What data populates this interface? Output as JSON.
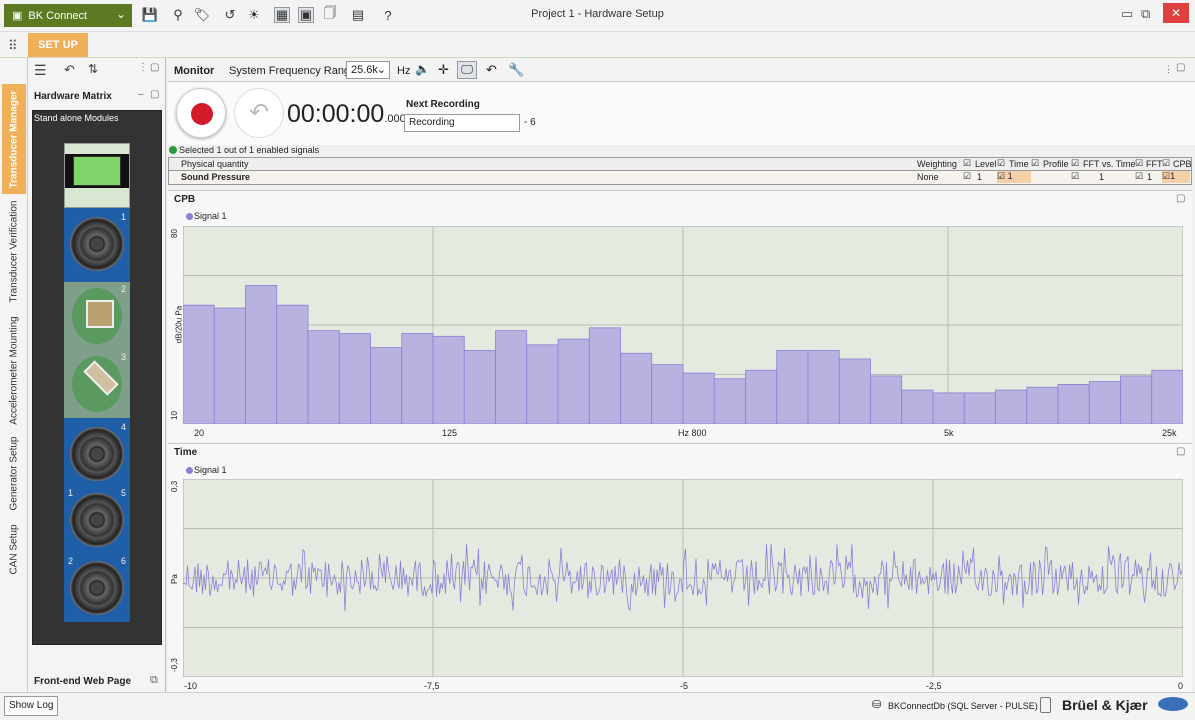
{
  "app": {
    "app_button": "BK Connect",
    "window_title": "Project 1 - Hardware Setup",
    "ribbon_tab": "SET UP"
  },
  "left_tabs": [
    "Transducer Manager",
    "Transducer Verification",
    "Accelerometer Mounting",
    "Generator Setup",
    "CAN Setup"
  ],
  "hardware_panel": {
    "title": "Hardware Matrix",
    "subtitle": "Stand alone Modules",
    "front_end": "Front-end Web Page",
    "channel_numbers": [
      "1",
      "2",
      "3",
      "4",
      "1",
      "5",
      "2",
      "6"
    ]
  },
  "monitor": {
    "title": "Monitor",
    "freq_label": "System Frequency Range:",
    "freq_value": "25.6k",
    "freq_unit": "Hz"
  },
  "recording": {
    "timer_main": "00:00:00",
    "timer_ms": ".000",
    "next_label": "Next Recording",
    "next_value": "Recording",
    "next_suffix": "- 6",
    "status": "Selected 1 out of 1 enabled signals"
  },
  "signal_table": {
    "headers": [
      "Physical quantity",
      "Weighting",
      "Level",
      "Time",
      "Profile",
      "FFT vs. Time",
      "FFT",
      "CPB"
    ],
    "row": {
      "quantity": "Sound Pressure",
      "weighting": "None",
      "level": "1",
      "time": "1",
      "fftvt": "1",
      "fft": "1",
      "cpb": "1"
    }
  },
  "chart_data": [
    {
      "type": "bar",
      "title": "CPB",
      "legend": "Signal 1",
      "ylabel": "dB/20u Pa",
      "ylim": [
        10,
        80
      ],
      "ytick_labels": [
        "80",
        "10"
      ],
      "xtick_labels": [
        "20",
        "125",
        "Hz 800",
        "5k",
        "25k"
      ],
      "color": "#b8b2e0",
      "values": [
        52,
        51,
        59,
        52,
        43,
        42,
        37,
        42,
        41,
        36,
        43,
        38,
        40,
        44,
        35,
        31,
        28,
        26,
        29,
        36,
        36,
        33,
        27,
        22,
        21,
        21,
        22,
        23,
        24,
        25,
        27,
        29
      ]
    },
    {
      "type": "line",
      "title": "Time",
      "legend": "Signal 1",
      "ylabel": "Pa",
      "ylim": [
        -0.3,
        0.3
      ],
      "ytick_labels": [
        "0,3",
        "Pa",
        "-0,3"
      ],
      "xlim": [
        -10,
        0
      ],
      "xtick_labels": [
        "-10",
        "-7,5",
        "-5",
        "-2,5",
        "0"
      ],
      "color": "#8d7fd6"
    }
  ],
  "status_bar": {
    "show_log": "Show Log",
    "db": "BKConnectDb (SQL Server - PULSE)",
    "brand": "Brüel & Kjær"
  }
}
